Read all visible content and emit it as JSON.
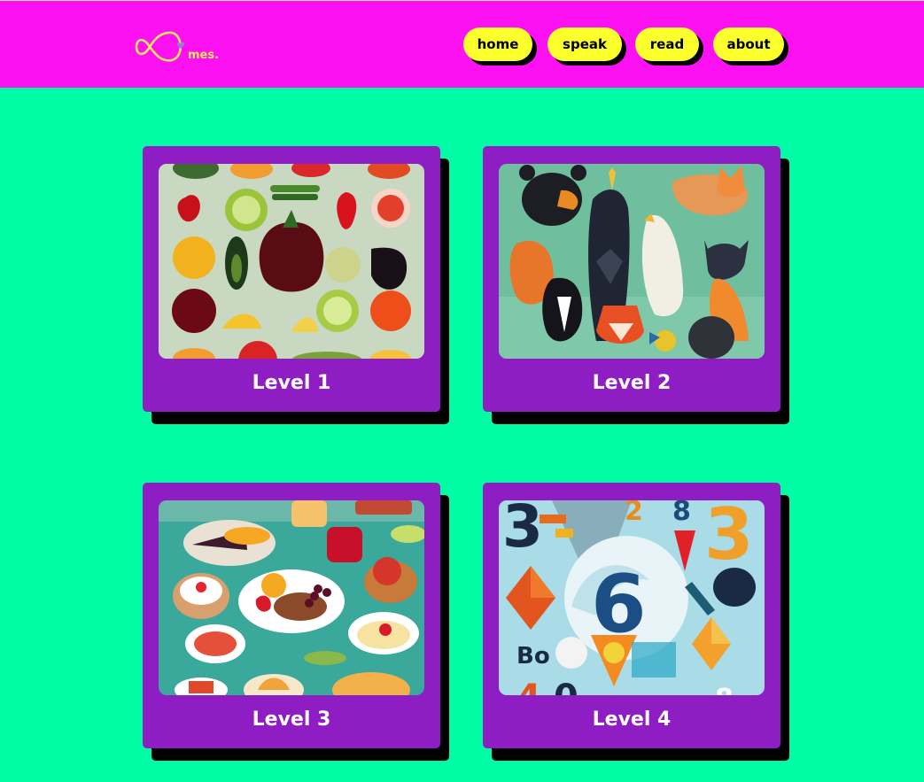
{
  "header": {
    "logo": {
      "text": "mes.",
      "icon": "infinity-heart-logo"
    },
    "nav": [
      {
        "label": "home"
      },
      {
        "label": "speak"
      },
      {
        "label": "read"
      },
      {
        "label": "about"
      }
    ]
  },
  "levels": [
    {
      "label": "Level 1",
      "image": "fruits-and-vegetables"
    },
    {
      "label": "Level 2",
      "image": "animals"
    },
    {
      "label": "Level 3",
      "image": "food-dishes"
    },
    {
      "label": "Level 4",
      "image": "numbers-letters-shapes"
    }
  ],
  "colors": {
    "page_background": "#00fda5",
    "header_background": "#fb11f1",
    "nav_button": "#fbff2b",
    "card": "#8e1dc3",
    "card_text": "#ffffff",
    "shadow": "#000000"
  }
}
